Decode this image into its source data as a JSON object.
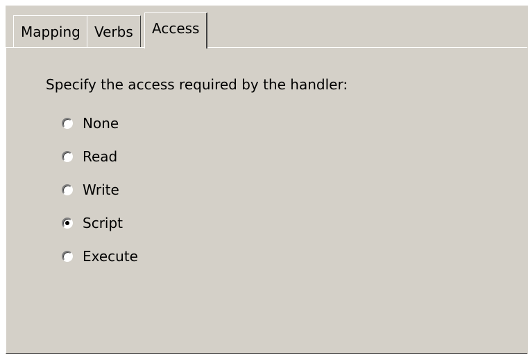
{
  "tabs": [
    {
      "label": "Mapping",
      "selected": false
    },
    {
      "label": "Verbs",
      "selected": false
    },
    {
      "label": "Access",
      "selected": true
    }
  ],
  "access_panel": {
    "prompt": "Specify the access required by the handler:",
    "options": [
      {
        "label": "None",
        "checked": false
      },
      {
        "label": "Read",
        "checked": false
      },
      {
        "label": "Write",
        "checked": false
      },
      {
        "label": "Script",
        "checked": true
      },
      {
        "label": "Execute",
        "checked": false
      }
    ]
  },
  "colors": {
    "dialog_background": "#d4d0c8",
    "page_background": "#ffffff"
  }
}
